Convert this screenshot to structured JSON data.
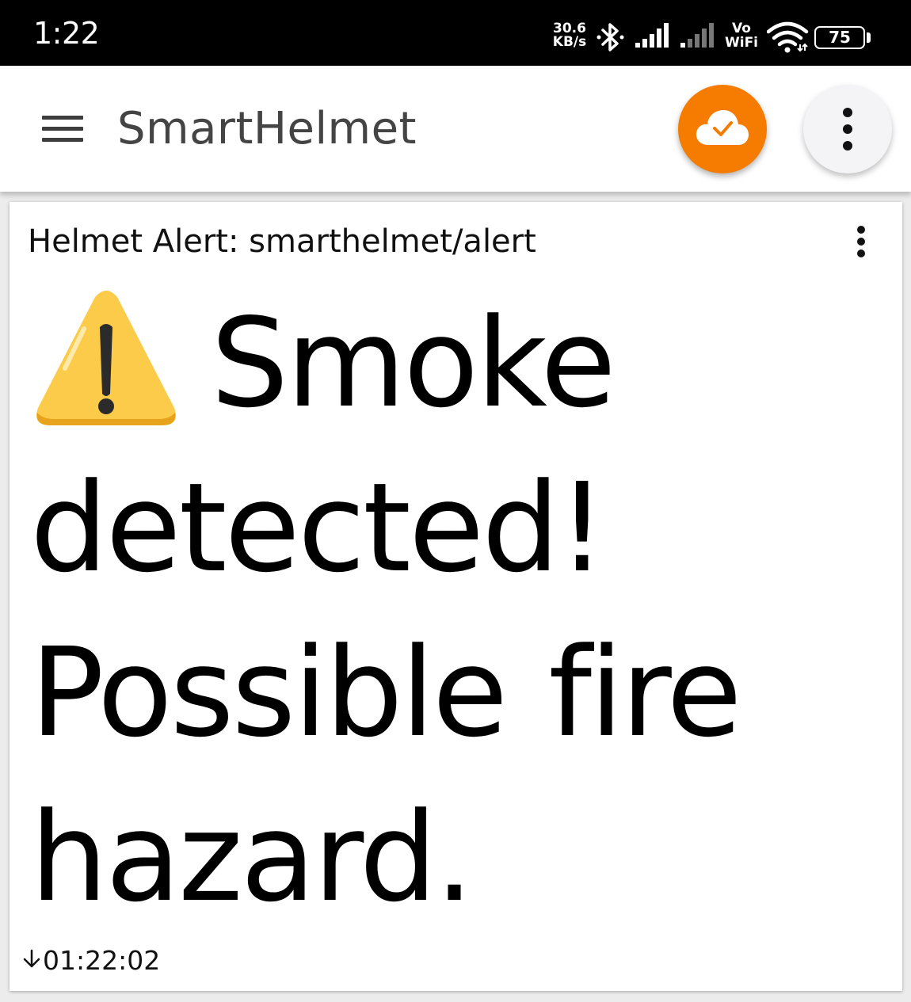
{
  "status_bar": {
    "time": "1:22",
    "net_speed_value": "30.6",
    "net_speed_unit": "KB/s",
    "vo_label": "Vo",
    "wifi_label": "WiFi",
    "battery_level": "75"
  },
  "app_bar": {
    "title": "SmartHelmet",
    "cloud_status_icon": "cloud-check-icon",
    "overflow_icon": "more-vert-icon"
  },
  "alert_card": {
    "title": "Helmet Alert: smarthelmet/alert",
    "warning_icon": "warning-icon",
    "message": "Smoke detected! Possible fire hazard.",
    "timestamp": "01:22:02",
    "direction_icon": "arrow-down-icon"
  },
  "colors": {
    "status_bar_bg": "#000000",
    "cloud_button_bg": "#f57c00",
    "warning_yellow": "#fdcb4a"
  }
}
